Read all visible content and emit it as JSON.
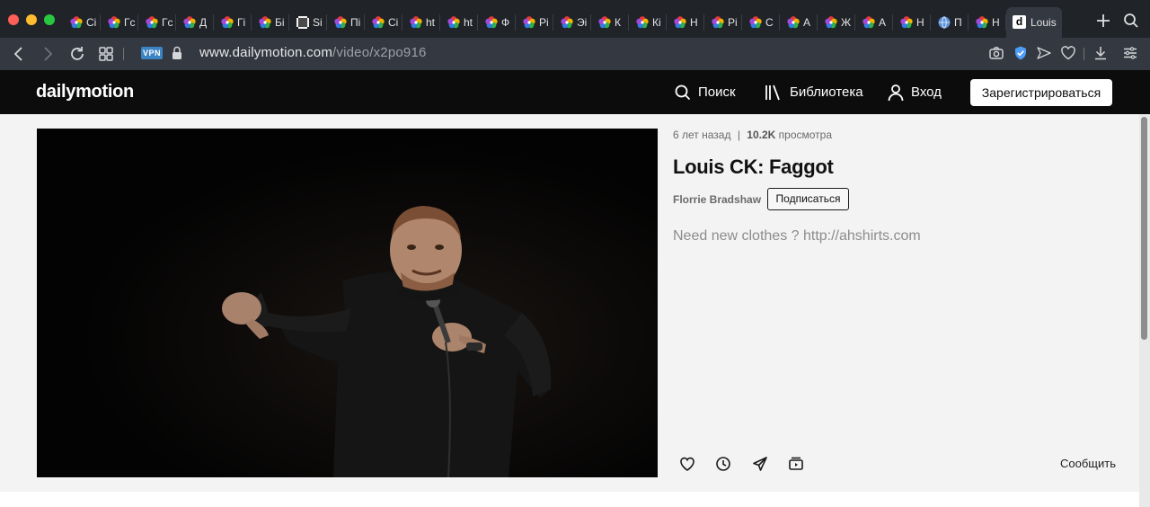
{
  "browser": {
    "tabs": [
      {
        "title": "Сі",
        "icon": "colorful-favicon"
      },
      {
        "title": "Гс",
        "icon": "colorful-favicon"
      },
      {
        "title": "Гс",
        "icon": "colorful-favicon"
      },
      {
        "title": "Д",
        "icon": "colorful-favicon"
      },
      {
        "title": "Гі",
        "icon": "colorful-favicon"
      },
      {
        "title": "Бі",
        "icon": "colorful-favicon"
      },
      {
        "title": "Sі",
        "icon": "film-favicon"
      },
      {
        "title": "Пі",
        "icon": "colorful-favicon"
      },
      {
        "title": "Сі",
        "icon": "colorful-favicon"
      },
      {
        "title": "ht",
        "icon": "colorful-favicon"
      },
      {
        "title": "ht",
        "icon": "colorful-favicon"
      },
      {
        "title": "Ф",
        "icon": "colorful-favicon"
      },
      {
        "title": "Рі",
        "icon": "colorful-favicon"
      },
      {
        "title": "Эі",
        "icon": "colorful-favicon"
      },
      {
        "title": "К",
        "icon": "colorful-favicon"
      },
      {
        "title": "Кі",
        "icon": "colorful-favicon"
      },
      {
        "title": "Н",
        "icon": "colorful-favicon"
      },
      {
        "title": "Рі",
        "icon": "colorful-favicon"
      },
      {
        "title": "С",
        "icon": "colorful-favicon"
      },
      {
        "title": "А",
        "icon": "colorful-favicon"
      },
      {
        "title": "Ж",
        "icon": "colorful-favicon"
      },
      {
        "title": "А",
        "icon": "colorful-favicon"
      },
      {
        "title": "Н",
        "icon": "colorful-favicon"
      },
      {
        "title": "П",
        "icon": "globe-favicon"
      },
      {
        "title": "Н",
        "icon": "colorful-favicon"
      }
    ],
    "active_tab": {
      "title": "Louis",
      "icon_letter": "d"
    },
    "vpn_label": "VPN",
    "url_host": "www.dailymotion.com",
    "url_path": "/video/x2po916"
  },
  "site": {
    "logo": "dailymotion",
    "nav": {
      "search": "Поиск",
      "library": "Библиотека",
      "login": "Вход",
      "signup": "Зарегистрироваться"
    }
  },
  "video": {
    "age": "6 лет назад",
    "separator": "|",
    "views": "10.2K",
    "views_suffix": "просмотра",
    "title": "Louis CK: Faggot",
    "channel": "Florrie Bradshaw",
    "subscribe": "Подписаться",
    "description": "Need new clothes ? http://ahshirts.com",
    "report": "Сообщить"
  },
  "colors": {
    "tabbar_bg": "#202328",
    "addressbar_bg": "#343841",
    "site_header_bg": "#0c0c0c",
    "page_bg": "#f3f3f3",
    "vpn_badge": "#3b84c3",
    "shield_blue": "#4e9cf5"
  }
}
